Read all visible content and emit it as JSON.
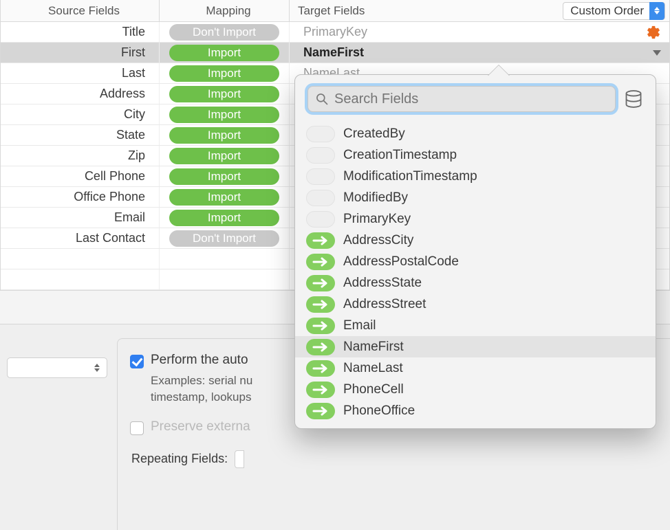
{
  "header": {
    "source_label": "Source Fields",
    "mapping_label": "Mapping",
    "target_label": "Target Fields",
    "order_select": "Custom Order"
  },
  "pills": {
    "import": "Import",
    "dont_import": "Don't Import"
  },
  "rows": [
    {
      "source": "Title",
      "status": "dont",
      "target": "PrimaryKey",
      "gear": true
    },
    {
      "source": "First",
      "status": "import",
      "target": "NameFirst",
      "selected": true,
      "chevron": true
    },
    {
      "source": "Last",
      "status": "import",
      "target": "NameLast"
    },
    {
      "source": "Address",
      "status": "import",
      "target": ""
    },
    {
      "source": "City",
      "status": "import",
      "target": ""
    },
    {
      "source": "State",
      "status": "import",
      "target": ""
    },
    {
      "source": "Zip",
      "status": "import",
      "target": ""
    },
    {
      "source": "Cell Phone",
      "status": "import",
      "target": ""
    },
    {
      "source": "Office Phone",
      "status": "import",
      "target": ""
    },
    {
      "source": "Email",
      "status": "import",
      "target": ""
    },
    {
      "source": "Last Contact",
      "status": "dont",
      "target": ""
    }
  ],
  "options": {
    "auto_enter_label": "Perform the auto",
    "examples_line1": "Examples: serial nu",
    "examples_line2": "timestamp, lookups",
    "preserve_label": "Preserve externa",
    "repeating_label": "Repeating Fields:"
  },
  "popover": {
    "search_placeholder": "Search Fields",
    "items": [
      {
        "name": "CreatedBy",
        "mapped": false
      },
      {
        "name": "CreationTimestamp",
        "mapped": false
      },
      {
        "name": "ModificationTimestamp",
        "mapped": false
      },
      {
        "name": "ModifiedBy",
        "mapped": false
      },
      {
        "name": "PrimaryKey",
        "mapped": false
      },
      {
        "name": "AddressCity",
        "mapped": true
      },
      {
        "name": "AddressPostalCode",
        "mapped": true
      },
      {
        "name": "AddressState",
        "mapped": true
      },
      {
        "name": "AddressStreet",
        "mapped": true
      },
      {
        "name": "Email",
        "mapped": true
      },
      {
        "name": "NameFirst",
        "mapped": true,
        "highlight": true
      },
      {
        "name": "NameLast",
        "mapped": true
      },
      {
        "name": "PhoneCell",
        "mapped": true
      },
      {
        "name": "PhoneOffice",
        "mapped": true
      }
    ]
  }
}
